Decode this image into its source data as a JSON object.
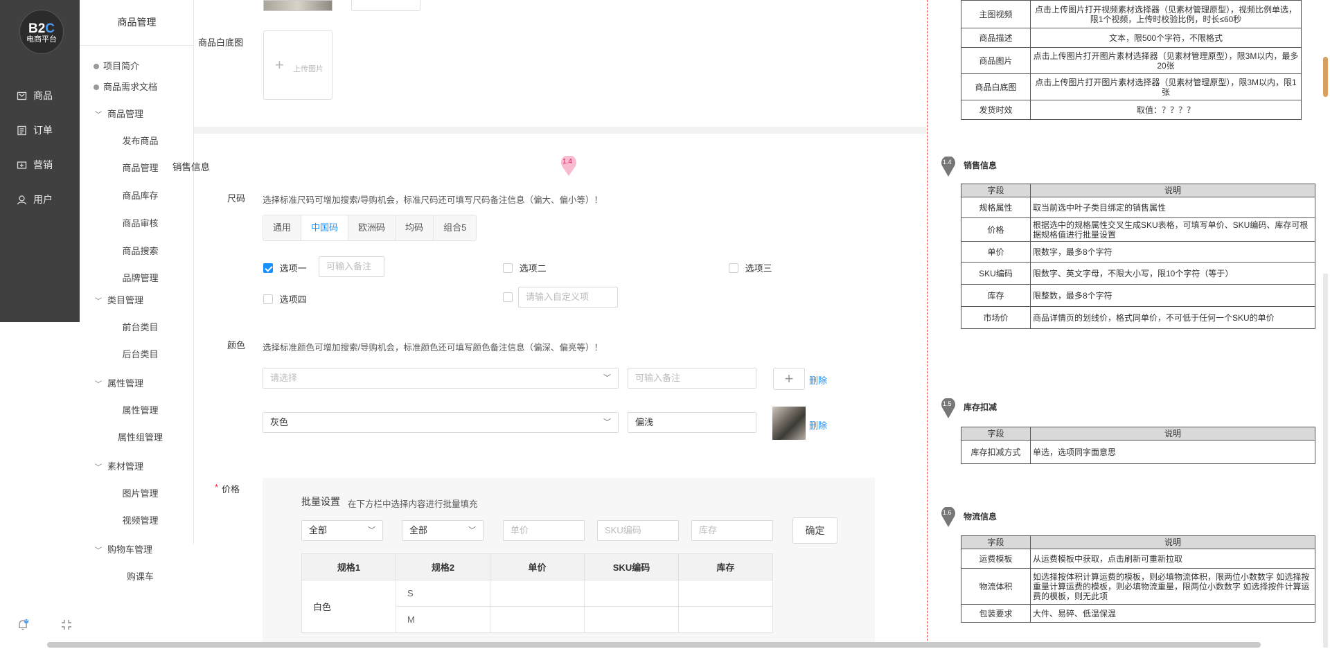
{
  "logo": {
    "line1_a": "B2",
    "line1_b": "C",
    "line2": "电商平台"
  },
  "main_nav": [
    "商品",
    "订单",
    "营销",
    "用户"
  ],
  "sub_nav": {
    "title": "商品管理",
    "doc_items": [
      "项目简介",
      "商品需求文档"
    ],
    "groups": [
      {
        "label": "商品管理",
        "children": [
          "发布商品",
          "商品管理",
          "商品库存",
          "商品审核",
          "商品搜索",
          "品牌管理"
        ]
      },
      {
        "label": "类目管理",
        "children": [
          "前台类目",
          "后台类目"
        ]
      },
      {
        "label": "属性管理",
        "children": [
          "属性管理",
          "属性组管理"
        ]
      },
      {
        "label": "素材管理",
        "children": [
          "图片管理",
          "视频管理"
        ]
      },
      {
        "label": "购物车管理",
        "children": [
          "购课车"
        ]
      }
    ]
  },
  "form": {
    "white_image_label": "商品白底图",
    "upload_label": "上传图片",
    "sales_section": "销售信息",
    "marker": "1.4",
    "size_label": "尺码",
    "size_hint": "选择标准尺码可增加搜索/导购机会，标准尺码还可填写尺码备注信息（偏大、偏小等）！",
    "size_tabs": [
      "通用",
      "中国码",
      "欧洲码",
      "均码",
      "组合5"
    ],
    "options": [
      "选项一",
      "选项二",
      "选项三",
      "选项四"
    ],
    "remark_placeholder": "可输入备注",
    "custom_placeholder": "请输入自定义项",
    "color_label": "颜色",
    "color_hint": "选择标准颜色可增加搜索/导购机会，标准颜色还可填写颜色备注信息（偏深、偏亮等）！",
    "color_select_placeholder": "请选择",
    "color_select_value": "灰色",
    "color_remark_value": "偏浅",
    "delete_label": "删除",
    "price_required": "*",
    "price_label": "价格",
    "batch_title": "批量设置",
    "batch_hint": "在下方栏中选择内容进行批量填充",
    "batch_select1": "全部",
    "batch_select2": "全部",
    "batch_unit_ph": "单价",
    "batch_sku_ph": "SKU编码",
    "batch_stock_ph": "库存",
    "confirm": "确定",
    "price_table": {
      "headers": [
        "规格1",
        "规格2",
        "单价",
        "SKU编码",
        "库存"
      ],
      "spec1": "白色",
      "rows": [
        "S",
        "M"
      ]
    }
  },
  "notes": {
    "top_table": [
      [
        "主图视频",
        "点击上传图片打开视频素材选择器（见素材管理原型），视频比例单选，限1个视频，上传时校验比例，时长≤60秒"
      ],
      [
        "商品描述",
        "文本，限500个字符，不限格式"
      ],
      [
        "商品图片",
        "点击上传图片打开图片素材选择器（见素材管理原型），限3M以内，最多20张"
      ],
      [
        "商品白底图",
        "点击上传图片打开图片素材选择器（见素材管理原型），限3M以内，限1张"
      ],
      [
        "发货时效",
        "取值：？？？？"
      ]
    ],
    "col_field": "字段",
    "col_desc": "说明",
    "sections": [
      {
        "num": "1.4",
        "title": "销售信息",
        "rows": [
          [
            "规格属性",
            "取当前选中叶子类目绑定的销售属性"
          ],
          [
            "价格",
            "根据选中的规格属性交叉生成SKU表格，可填写单价、SKU编码、库存可根据规格值进行批量设置"
          ],
          [
            "单价",
            "限数字，最多8个字符"
          ],
          [
            "SKU编码",
            "限数字、英文字母，不限大小写，限10个字符（等于）"
          ],
          [
            "库存",
            "限整数，最多8个字符"
          ],
          [
            "市场价",
            "商品详情页的划线价，格式同单价，不可低于任何一个SKU的单价"
          ]
        ]
      },
      {
        "num": "1.5",
        "title": "库存扣减",
        "rows": [
          [
            "库存扣减方式",
            "单选，选项同字面意思"
          ]
        ]
      },
      {
        "num": "1.6",
        "title": "物流信息",
        "rows": [
          [
            "运费模板",
            "从运费模板中获取，点击刷新可重新拉取"
          ],
          [
            "物流体积",
            "如选择按体积计算运费的模板，则必填物流体积，限两位小数数字 如选择按重量计算运费的模板，则必填物流重量，限两位小数数字 如选择按件计算运费的模板，则无此项"
          ],
          [
            "包装要求",
            "大件、易碎、低温保温"
          ]
        ]
      }
    ]
  },
  "bottom": {
    "bell_badge": "0"
  },
  "colors": {
    "accent": "#1890ff",
    "sidebar": "#404040",
    "marker": "#f48fb1",
    "divider": "#ee4444"
  }
}
